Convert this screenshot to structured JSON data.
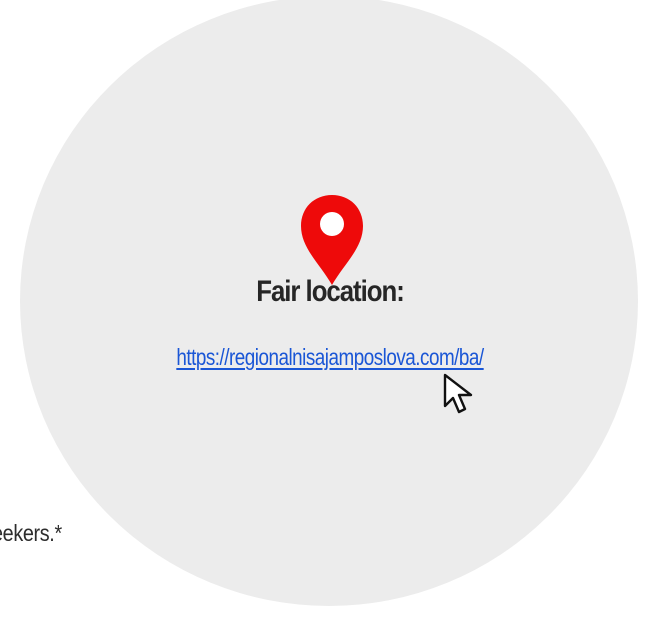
{
  "location": {
    "title": "Fair location:",
    "url": "https://regionalnisajamposlova.com/ba/"
  },
  "fragment": {
    "text": "eekers.*"
  },
  "icons": {
    "pin": "map-pin-icon",
    "cursor": "mouse-pointer-icon"
  },
  "colors": {
    "circle": "#ececec",
    "pin": "#ee0a0a",
    "link": "#1a56d6",
    "title": "#262626"
  }
}
